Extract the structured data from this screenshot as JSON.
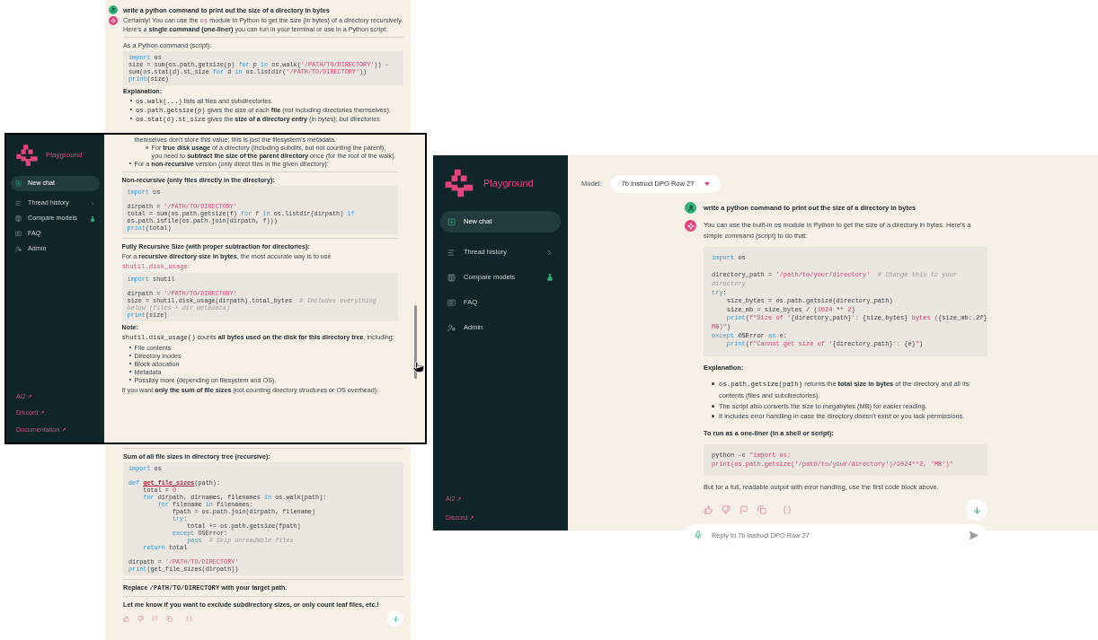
{
  "left_capture": {
    "top_blocks": [
      {
        "kind": "user",
        "text": "write a python command to print out the size of a directory in bytes"
      },
      {
        "kind": "assistant",
        "segments": [
          {
            "kind": "plain",
            "text": "Certainly! You can use the "
          },
          {
            "kind": "code_pink",
            "text": "os"
          },
          {
            "kind": "plain",
            "text": " module in Python to get the size (in bytes) of a directory recursively. Here's a "
          },
          {
            "kind": "bold",
            "text": "single command (one-liner)"
          },
          {
            "kind": "plain",
            "text": " you can run in your terminal or use in a Python script:"
          }
        ]
      },
      {
        "kind": "divider"
      },
      {
        "kind": "p",
        "segments": [
          {
            "kind": "plain",
            "text": "As a Python command (script):"
          }
        ]
      },
      {
        "kind": "code",
        "lines": [
          {
            "kind": "code",
            "tokens": [
              {
                "kind": "kw",
                "text": "import"
              },
              {
                "kind": "tx",
                "text": " os"
              }
            ]
          },
          {
            "kind": "code",
            "tokens": [
              {
                "kind": "tx",
                "text": "size = sum(os.path.getsize(p) "
              },
              {
                "kind": "kw",
                "text": "for"
              },
              {
                "kind": "tx",
                "text": " p "
              },
              {
                "kind": "kw",
                "text": "in"
              },
              {
                "kind": "tx",
                "text": " os.walk("
              },
              {
                "kind": "str",
                "text": "'/PATH/TO/DIRECTORY'"
              },
              {
                "kind": "tx",
                "text": ")) -"
              }
            ]
          },
          {
            "kind": "code",
            "tokens": [
              {
                "kind": "tx",
                "text": "sum(os.stat(d).st_size "
              },
              {
                "kind": "kw",
                "text": "for"
              },
              {
                "kind": "tx",
                "text": " d "
              },
              {
                "kind": "kw",
                "text": "in"
              },
              {
                "kind": "tx",
                "text": " os.listdir("
              },
              {
                "kind": "str",
                "text": "'/PATH/TO/DIRECTORY'"
              },
              {
                "kind": "tx",
                "text": "))"
              }
            ]
          },
          {
            "kind": "code",
            "tokens": [
              {
                "kind": "kw",
                "text": "print"
              },
              {
                "kind": "tx",
                "text": "(size)"
              }
            ]
          }
        ]
      },
      {
        "kind": "h",
        "text": "Explanation:"
      },
      {
        "kind": "bullets",
        "items": [
          {
            "continued": false,
            "segments": [
              {
                "kind": "code",
                "text": "os.walk(...)"
              },
              {
                "kind": "plain",
                "text": " lists all files and subdirectories."
              }
            ]
          },
          {
            "continued": false,
            "segments": [
              {
                "kind": "code",
                "text": "os.path.getsize(p)"
              },
              {
                "kind": "plain",
                "text": " gives the size of each "
              },
              {
                "kind": "bold",
                "text": "file"
              },
              {
                "kind": "plain",
                "text": " (not including directories themselves)."
              }
            ]
          },
          {
            "continued": false,
            "segments": [
              {
                "kind": "code",
                "text": "os.stat(d).st_size"
              },
              {
                "kind": "plain",
                "text": " gives the "
              },
              {
                "kind": "bold",
                "text": "size of a directory entry"
              },
              {
                "kind": "plain",
                "text": " (in bytes), but directories"
              }
            ]
          }
        ]
      }
    ],
    "window": {
      "sidebar": {
        "brand": "Playground",
        "items": [
          {
            "kind": "new",
            "label": "New chat",
            "selected": true
          },
          {
            "kind": "history",
            "label": "Thread history",
            "selected": false
          },
          {
            "kind": "compare",
            "label": "Compare models",
            "selected": false
          },
          {
            "kind": "faq",
            "label": "FAQ",
            "selected": false
          },
          {
            "kind": "admin",
            "label": "Admin",
            "selected": false
          }
        ],
        "links": [
          "Ai2 ↗",
          "Discord ↗",
          "Documentation ↗"
        ]
      },
      "blocks": [
        {
          "kind": "bullets",
          "items": [
            {
              "continued": true,
              "segments": [
                {
                  "kind": "plain",
                  "text": "themselves don't store this value; this is just the filesystem's metadata."
                }
              ],
              "children": [
                {
                  "continued": false,
                  "segments": [
                    {
                      "kind": "plain",
                      "text": "For "
                    },
                    {
                      "kind": "bold",
                      "text": "true disk usage"
                    },
                    {
                      "kind": "plain",
                      "text": " of a directory (including subdirs, but not counting the parent), you need to "
                    },
                    {
                      "kind": "bold",
                      "text": "subtract the size of the parent directory"
                    },
                    {
                      "kind": "plain",
                      "text": " once (for the root of the walk)."
                    }
                  ]
                }
              ]
            },
            {
              "continued": false,
              "segments": [
                {
                  "kind": "plain",
                  "text": "For a "
                },
                {
                  "kind": "bold",
                  "text": "non-recursive"
                },
                {
                  "kind": "plain",
                  "text": " version (only direct files in the given directory):"
                }
              ]
            }
          ]
        },
        {
          "kind": "divider"
        },
        {
          "kind": "h",
          "text": "Non-recursive (only files directly in the directory):"
        },
        {
          "kind": "code",
          "lines": [
            {
              "kind": "code",
              "tokens": [
                {
                  "kind": "kw",
                  "text": "import"
                },
                {
                  "kind": "tx",
                  "text": " os"
                }
              ]
            },
            {
              "kind": "blank"
            },
            {
              "kind": "code",
              "tokens": [
                {
                  "kind": "tx",
                  "text": "dirpath = "
                },
                {
                  "kind": "str",
                  "text": "'/PATH/TO/DIRECTORY'"
                }
              ]
            },
            {
              "kind": "code",
              "tokens": [
                {
                  "kind": "tx",
                  "text": "total = sum(os.path.getsize(f) "
                },
                {
                  "kind": "kw",
                  "text": "for"
                },
                {
                  "kind": "tx",
                  "text": " f "
                },
                {
                  "kind": "kw",
                  "text": "in"
                },
                {
                  "kind": "tx",
                  "text": " os.listdir(dirpath) "
                },
                {
                  "kind": "kw",
                  "text": "if"
                }
              ]
            },
            {
              "kind": "code",
              "tokens": [
                {
                  "kind": "tx",
                  "text": "os.path.isfile(os.path.join(dirpath, f)))"
                }
              ]
            },
            {
              "kind": "code",
              "tokens": [
                {
                  "kind": "kw",
                  "text": "print"
                },
                {
                  "kind": "tx",
                  "text": "(total)"
                }
              ]
            }
          ]
        },
        {
          "kind": "divider"
        },
        {
          "kind": "h",
          "text": "Fully Recursive Size (with proper subtraction for directories):"
        },
        {
          "kind": "p",
          "segments": [
            {
              "kind": "plain",
              "text": "For a "
            },
            {
              "kind": "bold",
              "text": "recursive directory size in bytes"
            },
            {
              "kind": "plain",
              "text": ", the most accurate way is to use"
            }
          ]
        },
        {
          "kind": "p",
          "segments": [
            {
              "kind": "code_pink",
              "text": "shutil.disk_usage"
            },
            {
              "kind": "plain",
              "text": ":"
            }
          ]
        },
        {
          "kind": "code",
          "lines": [
            {
              "kind": "code",
              "tokens": [
                {
                  "kind": "kw",
                  "text": "import"
                },
                {
                  "kind": "tx",
                  "text": " shutil"
                }
              ]
            },
            {
              "kind": "blank"
            },
            {
              "kind": "code",
              "tokens": [
                {
                  "kind": "tx",
                  "text": "dirpath = "
                },
                {
                  "kind": "str",
                  "text": "'/PATH/TO/DIRECTORY'"
                }
              ]
            },
            {
              "kind": "code",
              "tokens": [
                {
                  "kind": "tx",
                  "text": "size = shutil.disk_usage(dirpath).total_bytes  "
                },
                {
                  "kind": "cm",
                  "text": "# Includes everything"
                }
              ]
            },
            {
              "kind": "code",
              "tokens": [
                {
                  "kind": "cm",
                  "text": "below (files + dir metadata)"
                }
              ]
            },
            {
              "kind": "code",
              "tokens": [
                {
                  "kind": "kw",
                  "text": "print"
                },
                {
                  "kind": "tx",
                  "text": "(size)"
                }
              ]
            }
          ]
        },
        {
          "kind": "h",
          "text": "Note:"
        },
        {
          "kind": "p",
          "segments": [
            {
              "kind": "code",
              "text": "shutil.disk_usage()"
            },
            {
              "kind": "plain",
              "text": " counts "
            },
            {
              "kind": "bold",
              "text": "all bytes used on the disk for this directory tree"
            },
            {
              "kind": "plain",
              "text": ", including:"
            }
          ]
        },
        {
          "kind": "bullets",
          "items": [
            {
              "continued": false,
              "segments": [
                {
                  "kind": "plain",
                  "text": "File contents"
                }
              ]
            },
            {
              "continued": false,
              "segments": [
                {
                  "kind": "plain",
                  "text": "Directory inodes"
                }
              ]
            },
            {
              "continued": false,
              "segments": [
                {
                  "kind": "plain",
                  "text": "Block allocation"
                }
              ]
            },
            {
              "continued": false,
              "segments": [
                {
                  "kind": "plain",
                  "text": "Metadata"
                }
              ]
            },
            {
              "continued": false,
              "segments": [
                {
                  "kind": "plain",
                  "text": "Possibly more (depending on filesystem and OS)."
                }
              ]
            }
          ]
        },
        {
          "kind": "p",
          "segments": [
            {
              "kind": "plain",
              "text": "If you want "
            },
            {
              "kind": "bold",
              "text": "only the sum of file sizes"
            },
            {
              "kind": "plain",
              "text": " (not counting directory structures or OS overhead):"
            }
          ]
        }
      ]
    },
    "bottom_blocks": [
      {
        "kind": "divider"
      },
      {
        "kind": "h",
        "text": "Sum of all file sizes in directory tree (recursive):"
      },
      {
        "kind": "code",
        "lines": [
          {
            "kind": "code",
            "tokens": [
              {
                "kind": "kw",
                "text": "import"
              },
              {
                "kind": "tx",
                "text": " os"
              }
            ]
          },
          {
            "kind": "blank"
          },
          {
            "kind": "code",
            "tokens": [
              {
                "kind": "kw",
                "text": "def "
              },
              {
                "kind": "fn",
                "text": "get_file_sizes"
              },
              {
                "kind": "tx",
                "text": "(path):"
              }
            ]
          },
          {
            "kind": "code",
            "tokens": [
              {
                "kind": "tx",
                "text": "    total = "
              },
              {
                "kind": "num",
                "text": "0"
              }
            ]
          },
          {
            "kind": "code",
            "tokens": [
              {
                "kind": "kw",
                "text": "    for"
              },
              {
                "kind": "tx",
                "text": " dirpath, dirnames, filenames "
              },
              {
                "kind": "kw",
                "text": "in"
              },
              {
                "kind": "tx",
                "text": " os.walk(path):"
              }
            ]
          },
          {
            "kind": "code",
            "tokens": [
              {
                "kind": "kw",
                "text": "        for"
              },
              {
                "kind": "tx",
                "text": " filename "
              },
              {
                "kind": "kw",
                "text": "in"
              },
              {
                "kind": "tx",
                "text": " filenames:"
              }
            ]
          },
          {
            "kind": "code",
            "tokens": [
              {
                "kind": "tx",
                "text": "            fpath = os.path.join(dirpath, filename)"
              }
            ]
          },
          {
            "kind": "code",
            "tokens": [
              {
                "kind": "kw",
                "text": "            try"
              },
              {
                "kind": "tx",
                "text": ":"
              }
            ]
          },
          {
            "kind": "code",
            "tokens": [
              {
                "kind": "tx",
                "text": "                total += os.path.getsize(fpath)"
              }
            ]
          },
          {
            "kind": "code",
            "tokens": [
              {
                "kind": "kw",
                "text": "            except"
              },
              {
                "kind": "tx",
                "text": " OSError:"
              }
            ]
          },
          {
            "kind": "code",
            "tokens": [
              {
                "kind": "kw",
                "text": "                pass"
              },
              {
                "kind": "cm",
                "text": "  # Skip unreadable files"
              }
            ]
          },
          {
            "kind": "code",
            "tokens": [
              {
                "kind": "kw",
                "text": "    return"
              },
              {
                "kind": "tx",
                "text": " total"
              }
            ]
          },
          {
            "kind": "blank"
          },
          {
            "kind": "code",
            "tokens": [
              {
                "kind": "tx",
                "text": "dirpath = "
              },
              {
                "kind": "str",
                "text": "'/PATH/TO/DIRECTORY'"
              }
            ]
          },
          {
            "kind": "code",
            "tokens": [
              {
                "kind": "kw",
                "text": "print"
              },
              {
                "kind": "tx",
                "text": "(get_file_sizes(dirpath))"
              }
            ]
          }
        ]
      },
      {
        "kind": "divider"
      },
      {
        "kind": "bold_p",
        "segments": [
          {
            "kind": "plain",
            "text": "Replace "
          },
          {
            "kind": "code",
            "text": "/PATH/TO/DIRECTORY"
          },
          {
            "kind": "plain",
            "text": " with your target path."
          }
        ]
      },
      {
        "kind": "divider"
      },
      {
        "kind": "bold_p",
        "segments": [
          {
            "kind": "plain",
            "text": "Let me know if you want to exclude subdirectory sizes, or only count leaf files, etc.!"
          }
        ]
      },
      {
        "kind": "actions"
      }
    ]
  },
  "right_capture": {
    "sidebar": {
      "brand": "Playground",
      "items": [
        {
          "kind": "new",
          "label": "New chat",
          "selected": true
        },
        {
          "kind": "history",
          "label": "Thread history",
          "selected": false
        },
        {
          "kind": "compare",
          "label": "Compare models",
          "selected": false
        },
        {
          "kind": "faq",
          "label": "FAQ",
          "selected": false
        },
        {
          "kind": "admin",
          "label": "Admin",
          "selected": false
        }
      ],
      "links": [
        "Ai2 ↗",
        "Discord ↗"
      ]
    },
    "model_selector": {
      "label": "Model:",
      "value": "7b Instruct DPO Row 27"
    },
    "blocks": [
      {
        "kind": "user",
        "text": "write a python command to print out the size of a directory in bytes"
      },
      {
        "kind": "assistant",
        "segments": [
          {
            "kind": "plain",
            "text": "You can use the built-in os module in Python to get the size of a directory in bytes. Here's a simple command (script) to do that:"
          }
        ]
      },
      {
        "kind": "code",
        "lines": [
          {
            "kind": "code",
            "tokens": [
              {
                "kind": "kw",
                "text": "import"
              },
              {
                "kind": "tx",
                "text": " os"
              }
            ]
          },
          {
            "kind": "blank"
          },
          {
            "kind": "code",
            "tokens": [
              {
                "kind": "tx",
                "text": "directory_path = "
              },
              {
                "kind": "str",
                "text": "'/path/to/your/directory'"
              },
              {
                "kind": "cm",
                "text": "  # Change this to your"
              }
            ]
          },
          {
            "kind": "code",
            "tokens": [
              {
                "kind": "cm",
                "text": "directory"
              }
            ]
          },
          {
            "kind": "code",
            "tokens": [
              {
                "kind": "kw",
                "text": "try"
              },
              {
                "kind": "tx",
                "text": ":"
              }
            ]
          },
          {
            "kind": "code",
            "tokens": [
              {
                "kind": "tx",
                "text": "    size_bytes = os.path.getsize(directory_path)"
              }
            ]
          },
          {
            "kind": "code",
            "tokens": [
              {
                "kind": "tx",
                "text": "    size_mb = size_bytes / ("
              },
              {
                "kind": "num",
                "text": "1024"
              },
              {
                "kind": "tx",
                "text": " ** "
              },
              {
                "kind": "num",
                "text": "2"
              },
              {
                "kind": "tx",
                "text": ")"
              }
            ]
          },
          {
            "kind": "code",
            "tokens": [
              {
                "kind": "kw",
                "text": "    print"
              },
              {
                "kind": "tx",
                "text": "("
              },
              {
                "kind": "str",
                "text": "f\"Size of '"
              },
              {
                "kind": "tx",
                "text": "{directory_path}"
              },
              {
                "kind": "str",
                "text": "': "
              },
              {
                "kind": "tx",
                "text": "{size_bytes}"
              },
              {
                "kind": "str",
                "text": " bytes ("
              },
              {
                "kind": "tx",
                "text": "{size_mb:.2f}"
              }
            ]
          },
          {
            "kind": "code",
            "tokens": [
              {
                "kind": "str",
                "text": "MB)\""
              },
              {
                "kind": "tx",
                "text": ")"
              }
            ]
          },
          {
            "kind": "code",
            "tokens": [
              {
                "kind": "kw",
                "text": "except"
              },
              {
                "kind": "tx",
                "text": " OSError "
              },
              {
                "kind": "kw",
                "text": "as"
              },
              {
                "kind": "tx",
                "text": " e:"
              }
            ]
          },
          {
            "kind": "code",
            "tokens": [
              {
                "kind": "kw",
                "text": "    print"
              },
              {
                "kind": "tx",
                "text": "("
              },
              {
                "kind": "str",
                "text": "f\"Cannot get size of '"
              },
              {
                "kind": "tx",
                "text": "{directory_path}"
              },
              {
                "kind": "str",
                "text": "': "
              },
              {
                "kind": "tx",
                "text": "{e}"
              },
              {
                "kind": "str",
                "text": "\""
              },
              {
                "kind": "tx",
                "text": ")"
              }
            ]
          }
        ]
      },
      {
        "kind": "h",
        "text": "Explanation:"
      },
      {
        "kind": "bullets",
        "items": [
          {
            "continued": false,
            "segments": [
              {
                "kind": "code",
                "text": "os.path.getsize(path)"
              },
              {
                "kind": "plain",
                "text": " returns the "
              },
              {
                "kind": "bold",
                "text": "total size in bytes"
              },
              {
                "kind": "plain",
                "text": " of the directory and all its contents (files and subdirectories)."
              }
            ]
          },
          {
            "continued": false,
            "segments": [
              {
                "kind": "plain",
                "text": "The script also converts the size to megabytes (MB) for easier reading."
              }
            ]
          },
          {
            "continued": false,
            "segments": [
              {
                "kind": "plain",
                "text": "It includes error handling in case the directory doesn't exist or you lack permissions."
              }
            ]
          }
        ]
      },
      {
        "kind": "h",
        "text": "To run as a one-liner (in a shell or script):"
      },
      {
        "kind": "code",
        "lines": [
          {
            "kind": "code",
            "tokens": [
              {
                "kind": "tx",
                "text": "python -c "
              },
              {
                "kind": "str",
                "text": "\"import os;"
              }
            ]
          },
          {
            "kind": "code",
            "tokens": [
              {
                "kind": "str",
                "text": "print(os.path.getsize('/path/to/your/directory')/1024**2, 'MB')\""
              }
            ]
          }
        ]
      },
      {
        "kind": "p",
        "segments": [
          {
            "kind": "plain",
            "text": "But for a full, readable output with error handling, use the first code block above."
          }
        ]
      },
      {
        "kind": "actions"
      }
    ],
    "composer": {
      "placeholder": "Reply to 7b Instruct DPO Row 27"
    }
  }
}
